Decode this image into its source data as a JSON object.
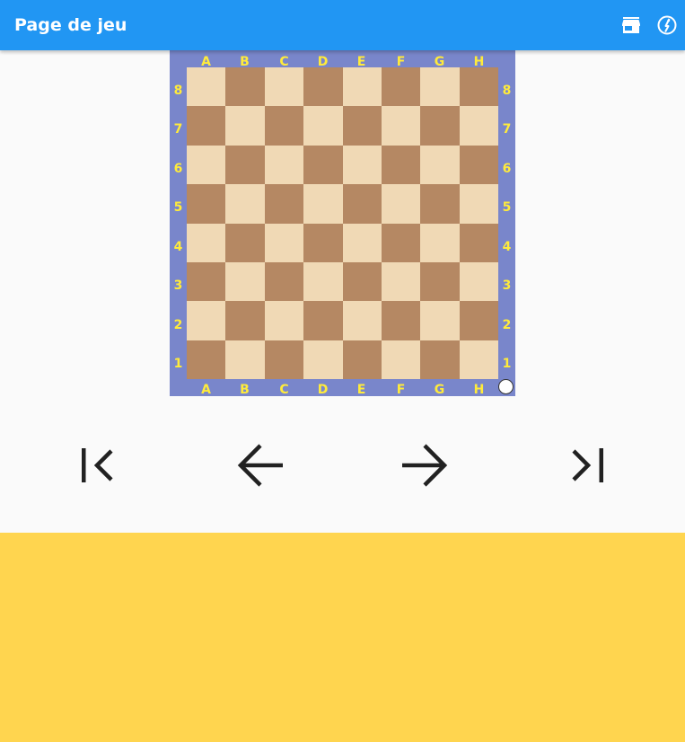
{
  "appbar": {
    "title": "Page de jeu",
    "background": "#2196f3",
    "actions": [
      {
        "name": "store-icon"
      },
      {
        "name": "exit-game-icon"
      }
    ]
  },
  "board": {
    "files": [
      "A",
      "B",
      "C",
      "D",
      "E",
      "F",
      "G",
      "H"
    ],
    "ranks": [
      "8",
      "7",
      "6",
      "5",
      "4",
      "3",
      "2",
      "1"
    ],
    "frame_color": "#7986cb",
    "coord_color": "#ffeb3b",
    "light_square_color": "#f0d9b5",
    "dark_square_color": "#b58863",
    "turn_indicator": "white"
  },
  "navigation": [
    {
      "name": "first-move-button",
      "icon": "first-page-icon"
    },
    {
      "name": "previous-move-button",
      "icon": "arrow-back-icon"
    },
    {
      "name": "next-move-button",
      "icon": "arrow-forward-icon"
    },
    {
      "name": "last-move-button",
      "icon": "last-page-icon"
    }
  ],
  "bottom_panel": {
    "background": "#ffd54f"
  }
}
